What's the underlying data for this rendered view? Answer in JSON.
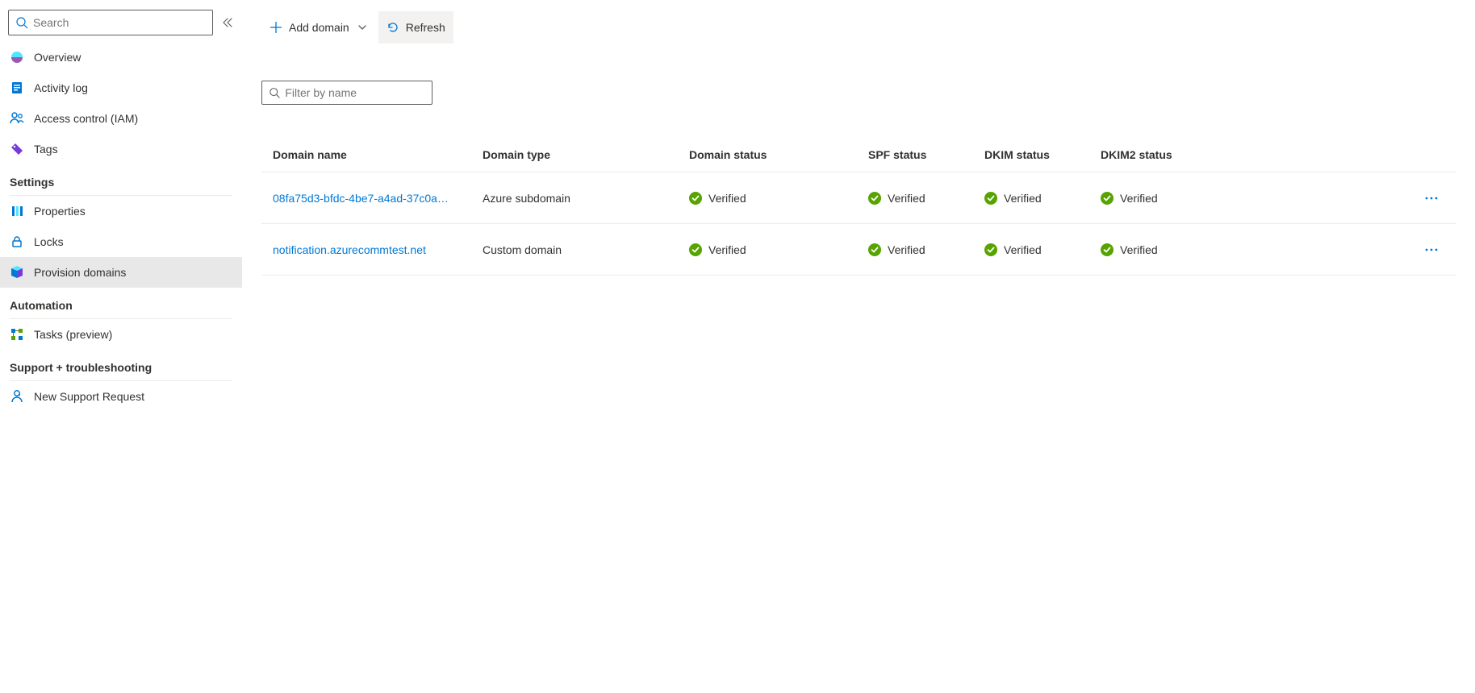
{
  "sidebar": {
    "search_placeholder": "Search",
    "items_top": [
      {
        "label": "Overview"
      },
      {
        "label": "Activity log"
      },
      {
        "label": "Access control (IAM)"
      },
      {
        "label": "Tags"
      }
    ],
    "section_settings": "Settings",
    "items_settings": [
      {
        "label": "Properties"
      },
      {
        "label": "Locks"
      },
      {
        "label": "Provision domains",
        "selected": true
      }
    ],
    "section_automation": "Automation",
    "items_automation": [
      {
        "label": "Tasks (preview)"
      }
    ],
    "section_support": "Support + troubleshooting",
    "items_support": [
      {
        "label": "New Support Request"
      }
    ]
  },
  "toolbar": {
    "add_domain": "Add domain",
    "refresh": "Refresh"
  },
  "filter": {
    "placeholder": "Filter by name"
  },
  "table": {
    "headers": {
      "name": "Domain name",
      "type": "Domain type",
      "status": "Domain status",
      "spf": "SPF status",
      "dkim": "DKIM status",
      "dkim2": "DKIM2 status"
    },
    "verified_label": "Verified",
    "rows": [
      {
        "name": "08fa75d3-bfdc-4be7-a4ad-37c0a…",
        "type": "Azure subdomain",
        "status": "Verified",
        "spf": "Verified",
        "dkim": "Verified",
        "dkim2": "Verified"
      },
      {
        "name": "notification.azurecommtest.net",
        "type": "Custom domain",
        "status": "Verified",
        "spf": "Verified",
        "dkim": "Verified",
        "dkim2": "Verified"
      }
    ]
  }
}
